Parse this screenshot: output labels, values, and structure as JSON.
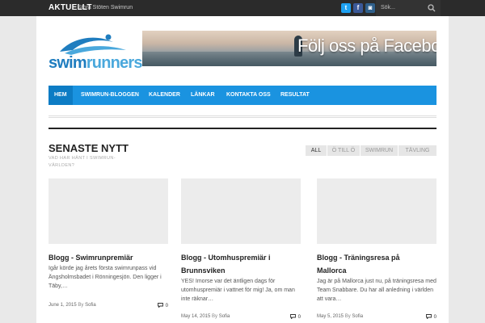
{
  "topbar": {
    "label": "AKTUELLT",
    "ticker": "Stora Stöten Swimrun",
    "social": {
      "twitter": "t",
      "facebook": "f",
      "instagram": "◙"
    },
    "search_placeholder": "Sök..."
  },
  "logo": {
    "part1": "swim",
    "part2": "runners"
  },
  "banner": {
    "text": "Följ oss på Facebook!"
  },
  "nav": {
    "items": [
      "HEM",
      "SWIMRUN-BLOGGEN",
      "KALENDER",
      "LÄNKAR",
      "KONTAKTA OSS",
      "RESULTAT"
    ],
    "active": "HEM"
  },
  "section": {
    "title": "SENASTE NYTT",
    "subtitle": "VAD HAR HÄNT I SWIMRUN-VÄRLDEN?"
  },
  "filters": [
    "ALL",
    "Ö TILL Ö",
    "SWIMRUN",
    "TÄVLING"
  ],
  "posts": [
    {
      "title_line1": "Blogg - Swimrunpremiär",
      "title_line2": "",
      "excerpt": "Igår körde jag årets första swimrunpass vid Ängsholmsbadet i Rönningesjön. Den ligger i Täby,…",
      "date": "June 1, 2015",
      "by": "By",
      "author": "Sofia",
      "comments": "0"
    },
    {
      "title_line1": "Blogg - Utomhuspremiär i",
      "title_line2": "Brunnsviken",
      "excerpt": "YES! Imorse var det äntligen dags för utomhuspremiär i vattnet för mig! Ja, om man inte räknar…",
      "date": "May 14, 2015",
      "by": "By",
      "author": "Sofia",
      "comments": "0"
    },
    {
      "title_line1": "Blogg - Träningsresa på",
      "title_line2": "Mallorca",
      "excerpt": "Jag är på Mallorca just nu, på träningsresa med Team Snabbare. Du har all anledning i världen att vara…",
      "date": "May 5, 2015",
      "by": "By",
      "author": "Sofia",
      "comments": "0"
    }
  ],
  "colors": {
    "nav": "#1a93e0",
    "topbar": "#2b2b2b",
    "accent": "#1f7dbf"
  }
}
